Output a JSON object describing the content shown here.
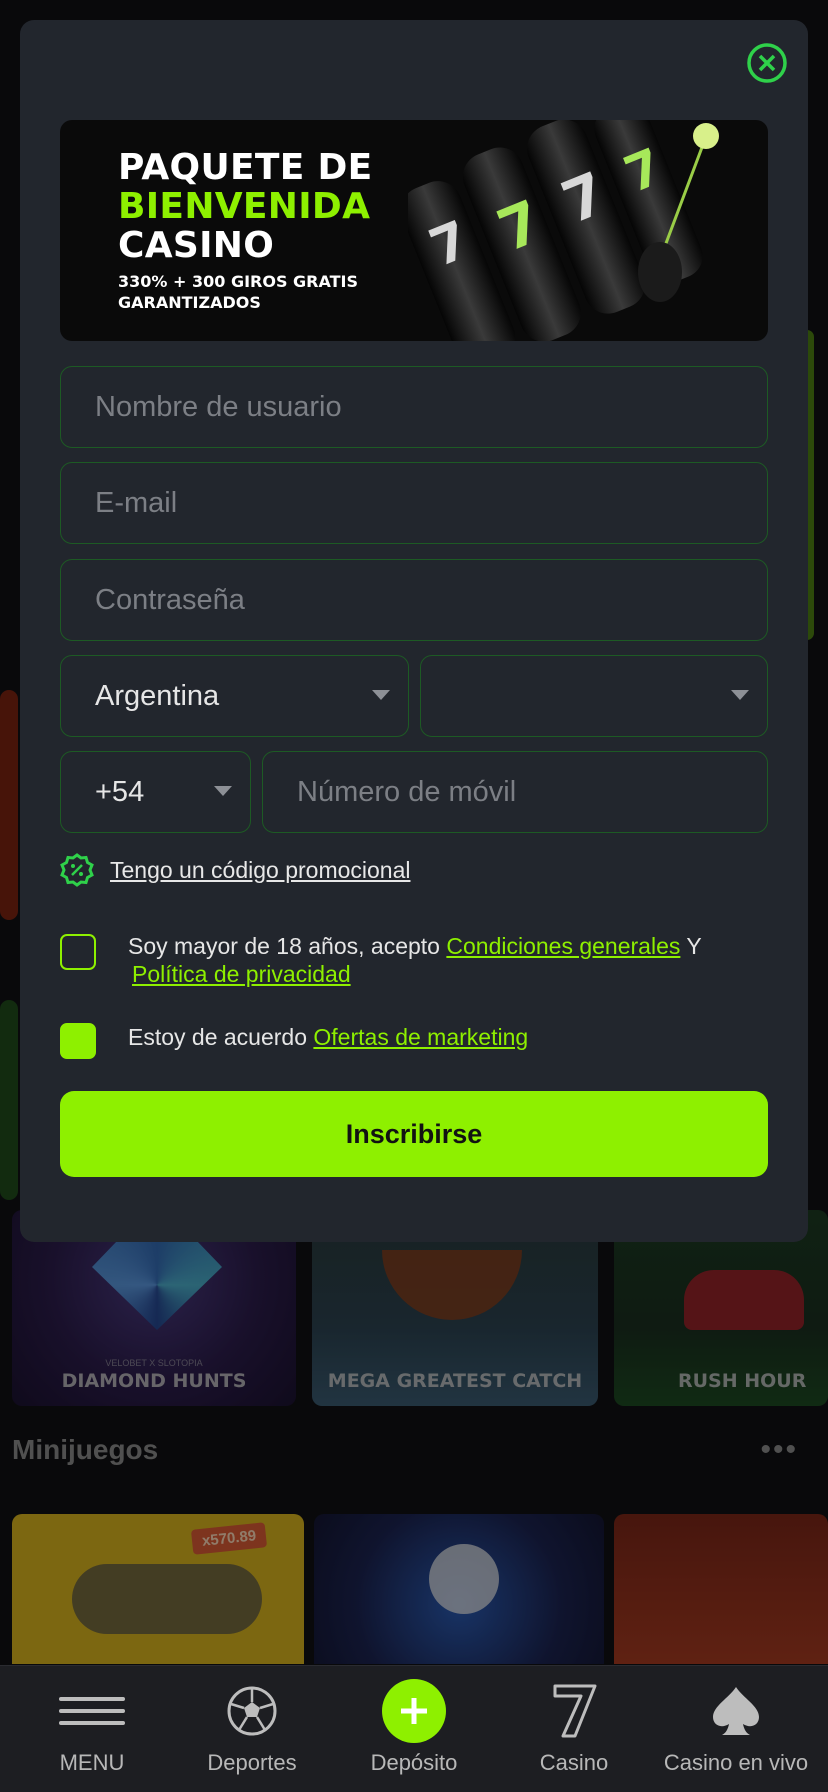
{
  "modal": {
    "banner": {
      "line1": "PAQUETE DE",
      "line2": "BIENVENIDA",
      "line3": "CASINO",
      "sub1": "330% + 300 GIROS GRATIS",
      "sub2": "GARANTIZADOS",
      "slot_symbol": "7"
    },
    "username_placeholder": "Nombre de usuario",
    "email_placeholder": "E-mail",
    "password_placeholder": "Contraseña",
    "country_value": "Argentina",
    "currency_value": "",
    "phone_code": "+54",
    "phone_placeholder": "Número de móvil",
    "promo_link": "Tengo un código promocional",
    "terms": {
      "prefix": "Soy mayor de 18 años, acepto",
      "conditions_link": "Condiciones generales",
      "conjunction": "Y",
      "privacy_link": "Política de privacidad",
      "checked": false
    },
    "marketing": {
      "prefix": "Estoy de acuerdo",
      "link": "Ofertas de marketing",
      "checked": true
    },
    "submit_label": "Inscribirse"
  },
  "background": {
    "games": [
      {
        "subtitle": "VELOBET X SLOTOPIA",
        "title": "DIAMOND HUNTS"
      },
      {
        "title": "MEGA GREATEST CATCH"
      },
      {
        "title": "RUSH HOUR"
      }
    ],
    "section_title": "Minijuegos",
    "more_icon": "ellipsis-icon",
    "mini_multiplier": "x570.89"
  },
  "bottom_nav": {
    "items": [
      {
        "label": "MENU",
        "icon": "menu-icon"
      },
      {
        "label": "Deportes",
        "icon": "soccer-ball-icon"
      },
      {
        "label": "Depósito",
        "icon": "plus-icon"
      },
      {
        "label": "Casino",
        "icon": "seven-icon"
      },
      {
        "label": "Casino en vivo",
        "icon": "spade-icon"
      }
    ]
  },
  "colors": {
    "accent": "#8EF000",
    "modal_bg": "#22262D",
    "field_border": "#1D5A24",
    "page_bg": "#101114"
  }
}
